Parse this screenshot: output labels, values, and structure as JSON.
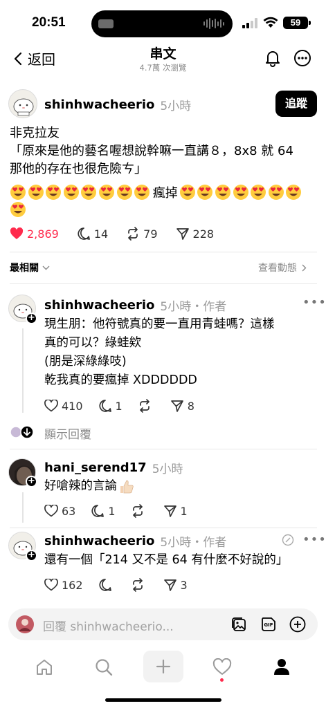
{
  "status": {
    "time": "20:51",
    "battery": "59"
  },
  "header": {
    "back_label": "返回",
    "title": "串文",
    "subtitle": "4.7萬 次瀏覽"
  },
  "post": {
    "username": "shinhwacheerio",
    "time": "5小時",
    "follow_label": "追蹤",
    "lines": [
      "非克拉友",
      "「原來是他的藝名喔想說幹嘛一直講８，8x8 就 64",
      "那他的存在也很危險ㄘ」"
    ],
    "emoji_word": "瘋掉",
    "actions": {
      "likes": "2,869",
      "comments": "14",
      "reposts": "79",
      "shares": "228"
    }
  },
  "sort": {
    "label": "最相關",
    "view_activity": "查看動態"
  },
  "replies": [
    {
      "username": "shinhwacheerio",
      "meta": "5小時・作者",
      "lines": [
        "現生朋：他符號真的要一直用青蛙嗎？這樣",
        "真的可以？綠蛙欸",
        "(朋是深綠綠吱)",
        "乾我真的要瘋掉 XDDDDDD"
      ],
      "likes": "410",
      "comments": "1",
      "reposts": "",
      "shares": "8"
    },
    {
      "username": "hani_serend17",
      "meta": "5小時",
      "lines": [
        "好嗆辣的言論"
      ],
      "likes": "63",
      "comments": "1",
      "reposts": "",
      "shares": "1"
    },
    {
      "username": "shinhwacheerio",
      "meta": "5小時・作者",
      "lines": [
        "還有一個「214 又不是 64 有什麼不好說的」"
      ],
      "likes": "162",
      "comments": "",
      "reposts": "",
      "shares": "3"
    }
  ],
  "show_replies_label": "顯示回覆",
  "reply_bar": {
    "placeholder": "回覆 shinhwacheerio..."
  },
  "colors": {
    "accent_red": "#ff2b4d",
    "muted": "#9a9a9a"
  }
}
